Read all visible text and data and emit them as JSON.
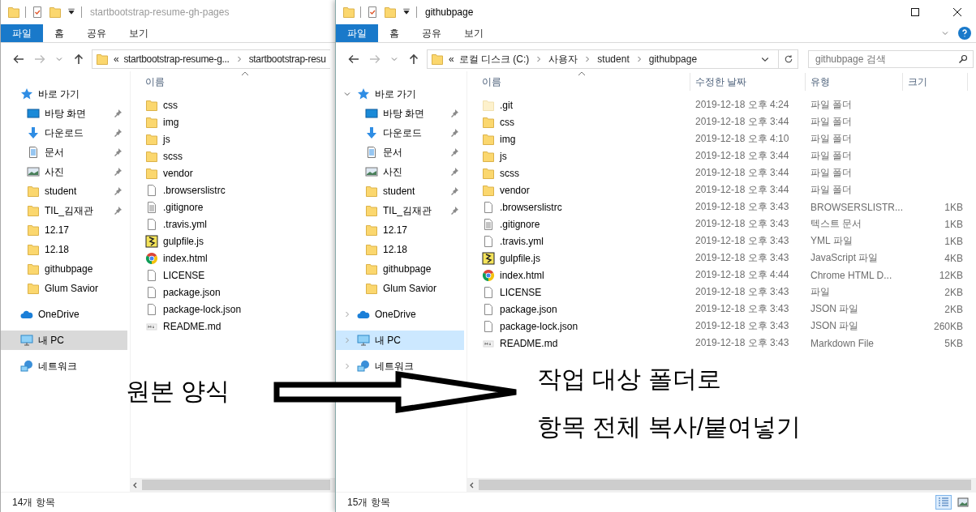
{
  "windows": [
    {
      "active": false,
      "title": "startbootstrap-resume-gh-pages",
      "ribbon_tabs": [
        {
          "label": "파일",
          "kind": "file-menu"
        },
        {
          "label": "홈",
          "kind": "tab"
        },
        {
          "label": "공유",
          "kind": "tab"
        },
        {
          "label": "보기",
          "kind": "tab"
        }
      ],
      "address": {
        "overflow": "«",
        "segments": [
          "startbootstrap-resume-g...",
          "startbootstrap-resu"
        ]
      },
      "nav": [
        {
          "label": "바로 가기",
          "kind": "star",
          "selected": false,
          "children": [
            {
              "label": "바탕 화면",
              "kind": "desktop",
              "pinned": true,
              "selected": false
            },
            {
              "label": "다운로드",
              "kind": "download",
              "pinned": true,
              "selected": false
            },
            {
              "label": "문서",
              "kind": "documents",
              "pinned": true,
              "selected": false
            },
            {
              "label": "사진",
              "kind": "pictures",
              "pinned": true,
              "selected": false
            },
            {
              "label": "student",
              "kind": "folder",
              "pinned": true,
              "selected": false
            },
            {
              "label": "TIL_김재관",
              "kind": "folder",
              "pinned": true,
              "selected": false
            },
            {
              "label": "12.17",
              "kind": "folder",
              "pinned": false,
              "selected": false
            },
            {
              "label": "12.18",
              "kind": "folder",
              "pinned": false,
              "selected": false
            },
            {
              "label": "githubpage",
              "kind": "folder",
              "pinned": false,
              "selected": false
            },
            {
              "label": "Glum Savior",
              "kind": "folder",
              "pinned": false,
              "selected": false
            }
          ]
        },
        {
          "label": "OneDrive",
          "kind": "cloud",
          "selected": false
        },
        {
          "label": "내 PC",
          "kind": "pc",
          "selected": true
        },
        {
          "label": "네트워크",
          "kind": "network",
          "selected": false
        }
      ],
      "columns": [
        "이름"
      ],
      "files": [
        {
          "name": "css",
          "kind": "folder"
        },
        {
          "name": "img",
          "kind": "folder"
        },
        {
          "name": "js",
          "kind": "folder"
        },
        {
          "name": "scss",
          "kind": "folder"
        },
        {
          "name": "vendor",
          "kind": "folder"
        },
        {
          "name": ".browserslistrc",
          "kind": "file"
        },
        {
          "name": ".gitignore",
          "kind": "text"
        },
        {
          "name": ".travis.yml",
          "kind": "file"
        },
        {
          "name": "gulpfile.js",
          "kind": "gulp"
        },
        {
          "name": "index.html",
          "kind": "chrome"
        },
        {
          "name": "LICENSE",
          "kind": "file"
        },
        {
          "name": "package.json",
          "kind": "file"
        },
        {
          "name": "package-lock.json",
          "kind": "file"
        },
        {
          "name": "README.md",
          "kind": "markdown"
        }
      ],
      "status": "14개 항목"
    },
    {
      "active": true,
      "title": "githubpage",
      "ribbon_tabs": [
        {
          "label": "파일",
          "kind": "file-menu"
        },
        {
          "label": "홈",
          "kind": "tab"
        },
        {
          "label": "공유",
          "kind": "tab"
        },
        {
          "label": "보기",
          "kind": "tab"
        }
      ],
      "address": {
        "overflow": "«",
        "segments": [
          "로컬 디스크 (C:)",
          "사용자",
          "student",
          "githubpage"
        ]
      },
      "search": {
        "placeholder": "githubpage 검색"
      },
      "nav": [
        {
          "label": "바로 가기",
          "kind": "star",
          "expanded": true,
          "selected": false,
          "children": [
            {
              "label": "바탕 화면",
              "kind": "desktop",
              "pinned": true,
              "selected": false
            },
            {
              "label": "다운로드",
              "kind": "download",
              "pinned": true,
              "selected": false
            },
            {
              "label": "문서",
              "kind": "documents",
              "pinned": true,
              "selected": false
            },
            {
              "label": "사진",
              "kind": "pictures",
              "pinned": true,
              "selected": false
            },
            {
              "label": "student",
              "kind": "folder",
              "pinned": true,
              "selected": false
            },
            {
              "label": "TIL_김재관",
              "kind": "folder",
              "pinned": true,
              "selected": false
            },
            {
              "label": "12.17",
              "kind": "folder",
              "pinned": false,
              "selected": false
            },
            {
              "label": "12.18",
              "kind": "folder",
              "pinned": false,
              "selected": false
            },
            {
              "label": "githubpage",
              "kind": "folder",
              "pinned": false,
              "selected": false
            },
            {
              "label": "Glum Savior",
              "kind": "folder",
              "pinned": false,
              "selected": false
            }
          ]
        },
        {
          "label": "OneDrive",
          "kind": "cloud",
          "expanded": false,
          "selected": false
        },
        {
          "label": "내 PC",
          "kind": "pc",
          "expanded": false,
          "selected": true
        },
        {
          "label": "네트워크",
          "kind": "network",
          "expanded": false,
          "selected": false
        }
      ],
      "columns": [
        "이름",
        "수정한 날짜",
        "유형",
        "크기"
      ],
      "files": [
        {
          "name": ".git",
          "kind": "folder-hidden",
          "date": "2019-12-18 오후 4:24",
          "type": "파일 폴더"
        },
        {
          "name": "css",
          "kind": "folder",
          "date": "2019-12-18 오후 3:44",
          "type": "파일 폴더"
        },
        {
          "name": "img",
          "kind": "folder",
          "date": "2019-12-18 오후 4:10",
          "type": "파일 폴더"
        },
        {
          "name": "js",
          "kind": "folder",
          "date": "2019-12-18 오후 3:44",
          "type": "파일 폴더"
        },
        {
          "name": "scss",
          "kind": "folder",
          "date": "2019-12-18 오후 3:44",
          "type": "파일 폴더"
        },
        {
          "name": "vendor",
          "kind": "folder",
          "date": "2019-12-18 오후 3:44",
          "type": "파일 폴더"
        },
        {
          "name": ".browserslistrc",
          "kind": "file",
          "date": "2019-12-18 오후 3:43",
          "type": "BROWSERSLISTR...",
          "size": "1KB"
        },
        {
          "name": ".gitignore",
          "kind": "text",
          "date": "2019-12-18 오후 3:43",
          "type": "텍스트 문서",
          "size": "1KB"
        },
        {
          "name": ".travis.yml",
          "kind": "file",
          "date": "2019-12-18 오후 3:43",
          "type": "YML 파일",
          "size": "1KB"
        },
        {
          "name": "gulpfile.js",
          "kind": "gulp",
          "date": "2019-12-18 오후 3:43",
          "type": "JavaScript 파일",
          "size": "4KB"
        },
        {
          "name": "index.html",
          "kind": "chrome",
          "date": "2019-12-18 오후 4:44",
          "type": "Chrome HTML D...",
          "size": "12KB"
        },
        {
          "name": "LICENSE",
          "kind": "file",
          "date": "2019-12-18 오후 3:43",
          "type": "파일",
          "size": "2KB"
        },
        {
          "name": "package.json",
          "kind": "file",
          "date": "2019-12-18 오후 3:43",
          "type": "JSON 파일",
          "size": "2KB"
        },
        {
          "name": "package-lock.json",
          "kind": "file",
          "date": "2019-12-18 오후 3:43",
          "type": "JSON 파일",
          "size": "260KB"
        },
        {
          "name": "README.md",
          "kind": "markdown",
          "date": "2019-12-18 오후 3:43",
          "type": "Markdown File",
          "size": "5KB"
        }
      ],
      "status": "15개 항목"
    }
  ],
  "annotation": {
    "source_label": "원본 양식",
    "target_lines": [
      "작업 대상 폴더로",
      "항목 전체 복사/붙여넣기"
    ]
  }
}
